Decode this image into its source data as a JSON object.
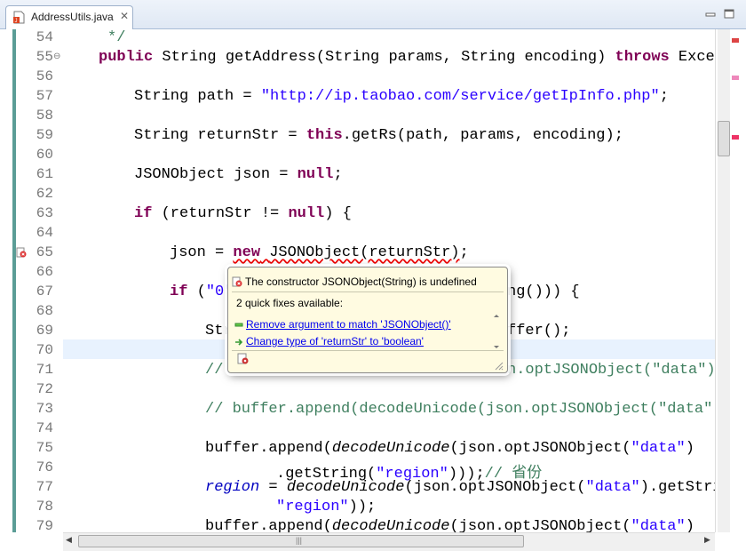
{
  "tab": {
    "title": "AddressUtils.java",
    "close": "✕"
  },
  "line_numbers": [
    "54",
    "55",
    "56",
    "57",
    "58",
    "59",
    "60",
    "61",
    "62",
    "63",
    "64",
    "65",
    "66",
    "67",
    "68",
    "69",
    "70",
    "71",
    "72",
    "73",
    "74",
    "75",
    "76",
    "77",
    "78",
    "79"
  ],
  "code": {
    "l54": "*/",
    "l55_kw1": "public",
    "l55_a": " String getAddress(String params, String encoding) ",
    "l55_kw2": "throws",
    "l55_b": " Except",
    "l57_a": "String path = ",
    "l57_str": "\"http://ip.taobao.com/service/getIpInfo.php\"",
    "l57_b": ";",
    "l59_a": "String returnStr = ",
    "l59_kw": "this",
    "l59_b": ".getRs(path, params, encoding);",
    "l61_a": "JSONObject json = ",
    "l61_kw": "null",
    "l61_b": ";",
    "l63_kw1": "if",
    "l63_a": " (returnStr != ",
    "l63_kw2": "null",
    "l63_b": ") {",
    "l65_a": "json = ",
    "l65_kw": "new",
    "l65_b": " ",
    "l65_squig": "JSONObject(returnStr)",
    "l65_c": ";",
    "l67_kw": "if",
    "l67_a": " (",
    "l67_str": "\"0\"",
    "l67_tail": "ng())) {",
    "l69_a": "Str",
    "l69_tail": "ffer();",
    "l71_a": "//",
    "l71_tail": "n.optJSONObject(\"data\").",
    "l73": "// buffer.append(decodeUnicode(json.optJSONObject(\"data\").",
    "l75_a": "buffer.append(",
    "l75_it": "decodeUnicode",
    "l75_b": "(json.optJSONObject(",
    "l75_str": "\"data\"",
    "l75_c": ")",
    "l76_a": ".getString(",
    "l76_str": "\"region\"",
    "l76_b": ")));",
    "l76_cmt": "// 省份",
    "l77_fld": "region",
    "l77_a": " = ",
    "l77_it": "decodeUnicode",
    "l77_b": "(json.optJSONObject(",
    "l77_str": "\"data\"",
    "l77_c": ").getStrin",
    "l78_str": "\"region\"",
    "l78_a": "));",
    "l79_a": "buffer.append(",
    "l79_it": "decodeUnicode",
    "l79_b": "(json.optJSONObject(",
    "l79_str": "\"data\"",
    "l79_c": ")"
  },
  "popup": {
    "error": "The constructor JSONObject(String) is undefined",
    "subtitle": "2 quick fixes available:",
    "fixes": [
      "Remove argument to match 'JSONObject()'",
      "Change type of 'returnStr' to 'boolean'"
    ]
  },
  "icons": [
    "java-file-icon",
    "close-icon",
    "minimize-icon",
    "maximize-icon",
    "fold-collapse-icon",
    "error-marker-icon",
    "error-icon",
    "remove-icon",
    "change-type-icon",
    "settings-icon",
    "resize-grip-icon"
  ],
  "colors": {
    "keyword": "#7f0055",
    "string": "#2a00ff",
    "comment": "#3f7f5f",
    "field": "#0000c0",
    "popup_bg": "#fffbe1",
    "gutter_bar": "#5b9d96"
  }
}
